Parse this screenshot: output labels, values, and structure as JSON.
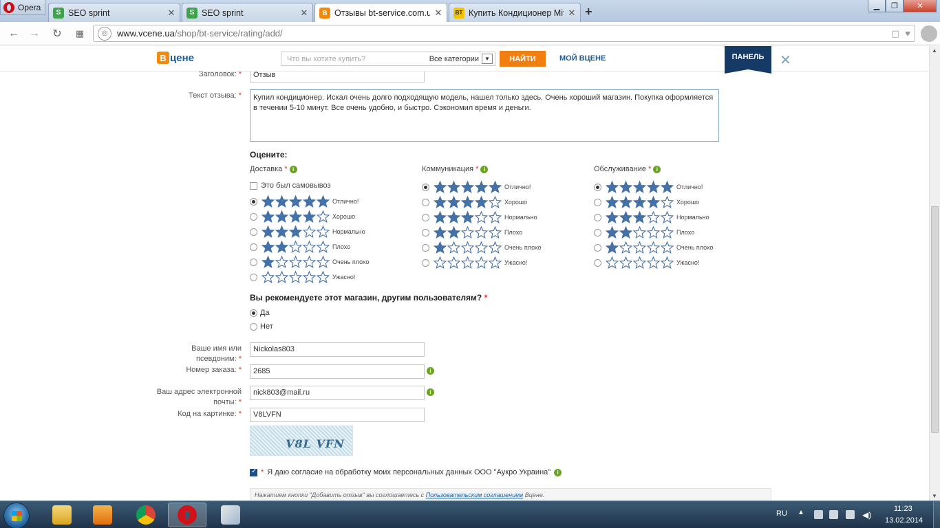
{
  "browser": {
    "menu_label": "Opera",
    "tabs": [
      {
        "title": "SEO sprint",
        "fav": "S",
        "fav_color": "#3fa34d"
      },
      {
        "title": "SEO sprint",
        "fav": "S",
        "fav_color": "#3fa34d"
      },
      {
        "title": "Отзывы bt-service.com.ua",
        "fav": "B",
        "fav_color": "#f28a10"
      },
      {
        "title": "Купить Кондиционер Mit",
        "fav": "BT",
        "fav_color": "#f2c400"
      }
    ],
    "active_tab": 2,
    "url_host": "www.vcene.ua",
    "url_path": "/shop/bt-service/rating/add/"
  },
  "site": {
    "logo_b": "В",
    "logo_rest": "цене",
    "search_placeholder": "Что вы хотите купить?",
    "category_select": "Все категории",
    "find_button": "НАЙТИ",
    "my_link": "МОЙ ВЦЕНЕ",
    "panel_button": "ПАНЕЛЬ"
  },
  "form": {
    "title_label": "Заголовок:",
    "title_value": "Отзыв",
    "review_label": "Текст отзыва:",
    "review_text": "Купил кондиционер. Искал очень долго подходящую модель, нашел только здесь. Очень хороший магазин. Покупка оформляется в течении 5-10 минут. Все очень удобно, и быстро. Сэкономил время и деньги.",
    "rate_heading": "Оцените:",
    "pickup_label": "Это был самовывоз",
    "rating_levels": [
      "Отлично!",
      "Хорошо",
      "Нормально",
      "Плохо",
      "Очень плохо",
      "Ужасно!"
    ],
    "rating_columns": [
      {
        "title": "Доставка",
        "selected": 0
      },
      {
        "title": "Коммуникация",
        "selected": 0
      },
      {
        "title": "Обслуживание",
        "selected": 0
      }
    ],
    "recommend_question": "Вы рекомендуете этот магазин, другим пользователям?",
    "recommend_yes": "Да",
    "recommend_no": "Нет",
    "recommend_selected": "yes",
    "name_label_1": "Ваше имя или",
    "name_label_2": "псевдоним:",
    "name_value": "Nickolas803",
    "order_label": "Номер заказа:",
    "order_value": "2685",
    "email_label_1": "Ваш адрес электронной",
    "email_label_2": "почты:",
    "email_value": "nick803@mail.ru",
    "captcha_label": "Код на картинке:",
    "captcha_value": "V8LVFN",
    "captcha_image_text": "V8L VFN",
    "consent_text": "Я даю согласие на обработку моих персональных данных ООО \"Аукро Украина\"",
    "consent_checked": true,
    "terms_prefix": "Нажатием кнопки \"Добавить отзыв\" вы соглошаетесь с ",
    "terms_link": "Пользовательским соглашением",
    "terms_suffix": " Вцене."
  },
  "taskbar": {
    "language": "RU",
    "time": "11:23",
    "date": "13.02.2014"
  },
  "colors": {
    "star": "#4471a8",
    "accent_orange": "#f07e10",
    "panel_navy": "#163a66"
  }
}
